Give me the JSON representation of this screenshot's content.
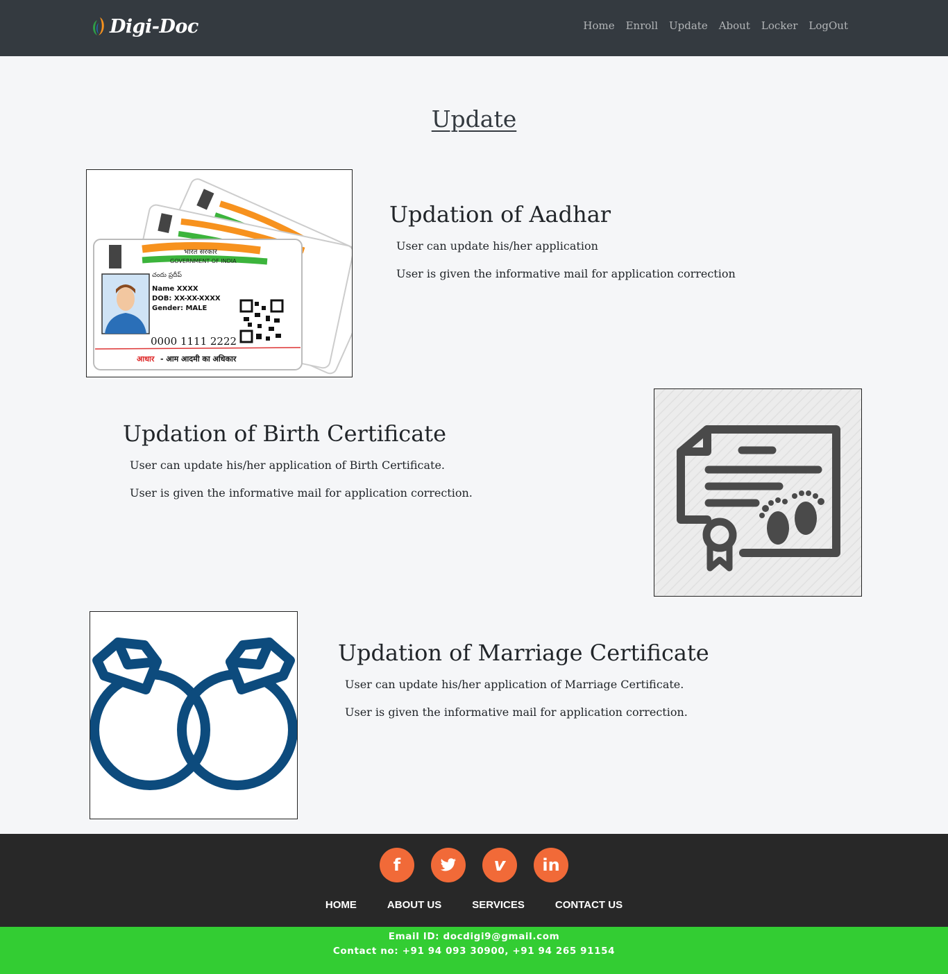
{
  "brand": {
    "name": "Digi-Doc"
  },
  "nav": [
    "Home",
    "Enroll",
    "Update",
    "About",
    "Locker",
    "LogOut"
  ],
  "page_title": "Update",
  "sections": [
    {
      "title": "Updation of Aadhar",
      "lines": [
        "User can update his/her application",
        "User is given the informative mail for application correction"
      ],
      "card": {
        "header_hi": "भारत सरकार",
        "header_en": "GOVERNMENT OF INDIA",
        "name_local": "చందు ప్రదీప్",
        "name": "Name XXXX",
        "dob": "DOB: XX-XX-XXXX",
        "gender": "Gender: MALE",
        "number": "0000 1111 2222",
        "tag_red": "आधार",
        "tag_rest": "- आम आदमी का अधिकार"
      }
    },
    {
      "title": "Updation of Birth Certificate",
      "lines": [
        "User can update his/her application of Birth Certificate.",
        "User is given the informative mail for application correction."
      ]
    },
    {
      "title": "Updation of Marriage Certificate",
      "lines": [
        "User can update his/her application of Marriage Certificate.",
        "User is given the informative mail for application correction."
      ]
    }
  ],
  "footer": {
    "socials": [
      {
        "icon": "facebook-icon",
        "glyph": "f"
      },
      {
        "icon": "twitter-icon",
        "glyph": "🐦"
      },
      {
        "icon": "vimeo-icon",
        "glyph": "v"
      },
      {
        "icon": "linkedin-icon",
        "glyph": "in"
      }
    ],
    "links": [
      "HOME",
      "ABOUT US",
      "SERVICES",
      "CONTACT US"
    ],
    "email": "Email ID: docdigi9@gmail.com",
    "contact": "Contact no: +91 94 093 30900, +91 94 265 91154"
  },
  "colors": {
    "navbar": "#343a40",
    "footer": "#282828",
    "social": "#f16a38",
    "contact_bar": "#33cd33",
    "rings": "#0d4b7d",
    "birth_icon": "#4a4a4a"
  }
}
